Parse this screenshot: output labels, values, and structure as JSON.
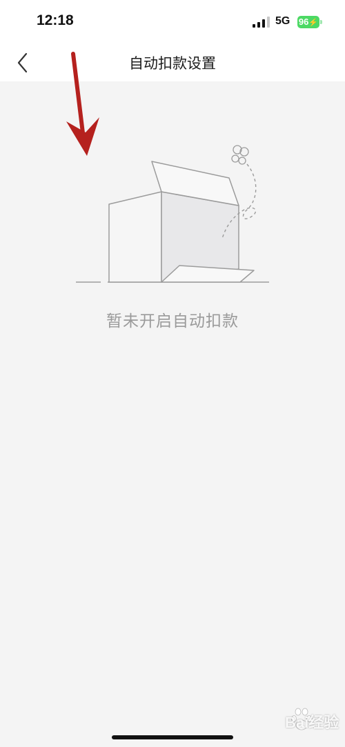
{
  "status_bar": {
    "time": "12:18",
    "network": "5G",
    "battery": "96",
    "battery_color": "#4cd964"
  },
  "nav": {
    "back_icon": "chevron-left-icon",
    "title": "自动扣款设置"
  },
  "empty_state": {
    "illustration_icon": "empty-box-icon",
    "message": "暂未开启自动扣款"
  },
  "annotation": {
    "arrow_icon": "red-arrow-icon",
    "color": "#b5211e"
  },
  "watermark": {
    "text": "Bai经验"
  }
}
